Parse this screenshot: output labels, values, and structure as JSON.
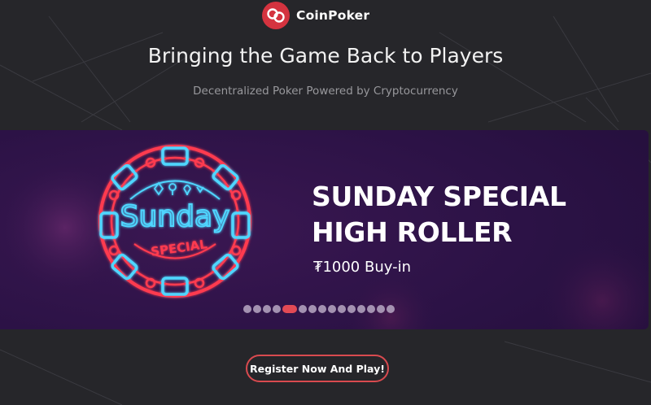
{
  "brand": {
    "name": "CoinPoker",
    "icon": "coinpoker-logo-icon",
    "color": "#d4333f"
  },
  "hero": {
    "title": "Bringing the Game Back to Players",
    "subtitle": "Decentralized Poker Powered by Cryptocurrency"
  },
  "banner": {
    "chip_line1": "Sunday",
    "chip_line2": "SPECIAL",
    "headline_line1": "SUNDAY SPECIAL",
    "headline_line2": "HIGH ROLLER",
    "buyin": "₮1000 Buy-in",
    "slide_count": 15,
    "active_slide": 4,
    "colors": {
      "neon_red": "#ff3b4f",
      "neon_blue": "#4fd6ff",
      "background": "#2b1245"
    }
  },
  "cta": {
    "label": "Register Now And Play!",
    "border_color": "#d94a4f"
  }
}
